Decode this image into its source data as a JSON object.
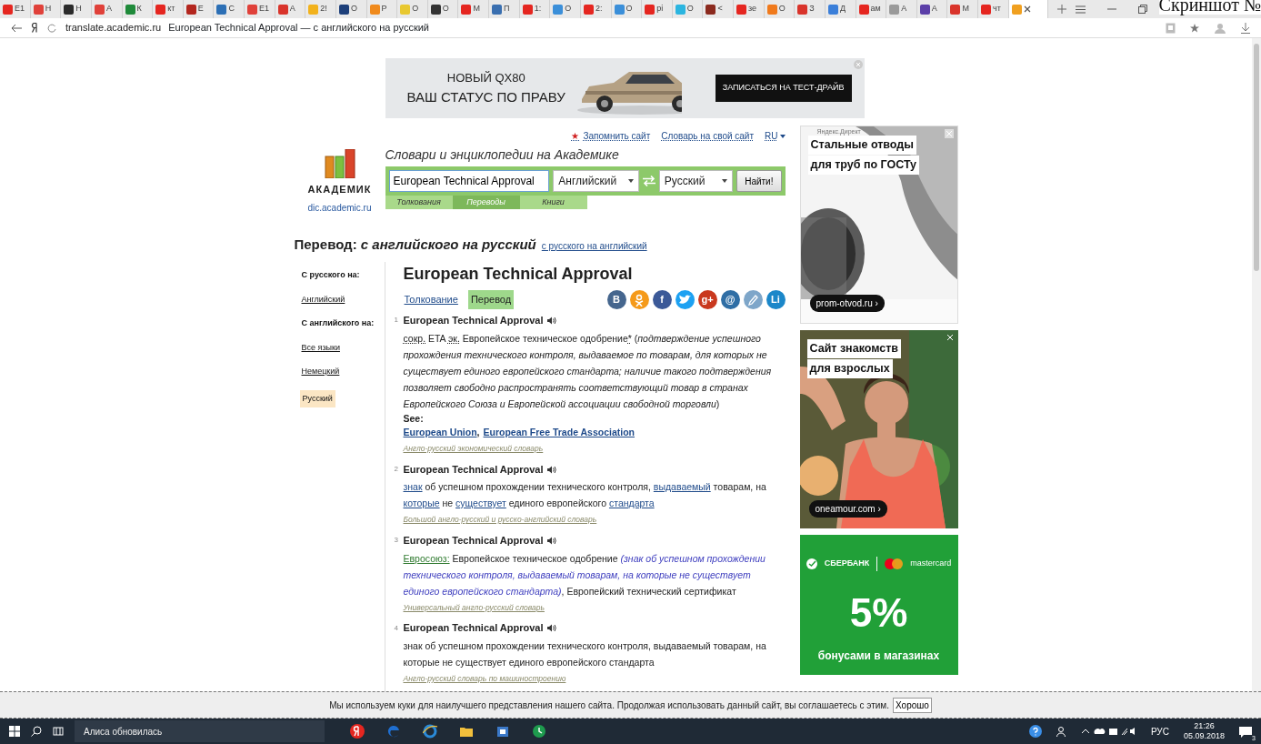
{
  "browser": {
    "tabs": [
      {
        "label": "Е1",
        "color": "#e52620",
        "selected": false
      },
      {
        "label": "Н",
        "color": "#e0413a",
        "selected": false
      },
      {
        "label": "Н",
        "color": "#2b2b2b",
        "selected": false
      },
      {
        "label": "А",
        "color": "#e0413a",
        "selected": false
      },
      {
        "label": "К",
        "color": "#1f8a3a",
        "selected": false
      },
      {
        "label": "кт",
        "color": "#e52620",
        "selected": false
      },
      {
        "label": "Е",
        "color": "#b3261e",
        "selected": false
      },
      {
        "label": "С",
        "color": "#2c6fb5",
        "selected": false
      },
      {
        "label": "Е1",
        "color": "#e0413a",
        "selected": false
      },
      {
        "label": "А",
        "color": "#d9342b",
        "selected": false
      },
      {
        "label": "2!",
        "color": "#f2b21c",
        "selected": false
      },
      {
        "label": "О",
        "color": "#1d3f7a",
        "selected": false
      },
      {
        "label": "Р",
        "color": "#f08a1c",
        "selected": false
      },
      {
        "label": "О",
        "color": "#e8c830",
        "selected": false
      },
      {
        "label": "О",
        "color": "#333333",
        "selected": false
      },
      {
        "label": "М",
        "color": "#e52620",
        "selected": false
      },
      {
        "label": "П",
        "color": "#3a6fb0",
        "selected": false
      },
      {
        "label": "1:",
        "color": "#e52620",
        "selected": false
      },
      {
        "label": "О",
        "color": "#3b8fd9",
        "selected": false
      },
      {
        "label": "2:",
        "color": "#e52620",
        "selected": false
      },
      {
        "label": "О",
        "color": "#3b8fd9",
        "selected": false
      },
      {
        "label": "рі",
        "color": "#e52620",
        "selected": false
      },
      {
        "label": "О",
        "color": "#2bb5e0",
        "selected": false
      },
      {
        "label": "<",
        "color": "#8b2a1e",
        "selected": false
      },
      {
        "label": "зе",
        "color": "#e52620",
        "selected": false
      },
      {
        "label": "О",
        "color": "#f07a1c",
        "selected": false
      },
      {
        "label": "З",
        "color": "#d9342b",
        "selected": false
      },
      {
        "label": "Д",
        "color": "#3b7fd9",
        "selected": false
      },
      {
        "label": "ам",
        "color": "#e52620",
        "selected": false
      },
      {
        "label": "А",
        "color": "#9a9a9a",
        "selected": false
      },
      {
        "label": "А",
        "color": "#5b3fa8",
        "selected": false
      },
      {
        "label": "М",
        "color": "#d9342b",
        "selected": false
      },
      {
        "label": "чт",
        "color": "#e52620",
        "selected": false
      },
      {
        "color": "#f0a020",
        "selected": true
      }
    ],
    "corner_caption": "Скриншот №",
    "address": {
      "domain": "translate.academic.ru",
      "title": "European Technical Approval — с английского на русский"
    }
  },
  "banner": {
    "line_1": "НОВЫЙ QX80",
    "line_2": "ВАШ СТАТУС ПО ПРАВУ",
    "cta": "ЗАПИСАТЬСЯ НА ТЕСТ-ДРАЙВ"
  },
  "top_links": [
    {
      "label": "Запомнить сайт",
      "star": "★"
    },
    {
      "label": "Словарь на свой сайт"
    },
    {
      "label": "RU"
    }
  ],
  "logo": {
    "name": "АКАДЕМИК",
    "domain": "dic.academic.ru"
  },
  "search": {
    "heading": "Словари и энциклопедии на Академике",
    "query": "European Technical Approval",
    "from_lang": "Английский",
    "to_lang": "Русский",
    "button": "Найти!",
    "tabs": [
      {
        "label": "Толкования",
        "selected": false
      },
      {
        "label": "Переводы",
        "selected": true
      },
      {
        "label": "Книги",
        "selected": false
      }
    ]
  },
  "page_title": {
    "prefix": "Перевод:",
    "direction": "с английского на русский",
    "reverse_link": "с русского на английский"
  },
  "sidebar": [
    {
      "kind": "heading",
      "label": "С русского на:"
    },
    {
      "kind": "link",
      "label": "Английский",
      "selected": false
    },
    {
      "kind": "heading",
      "label": "С английского на:"
    },
    {
      "kind": "link",
      "label": "Все языки",
      "selected": false
    },
    {
      "kind": "link",
      "label": "Немецкий",
      "selected": false
    },
    {
      "kind": "link",
      "label": "Русский",
      "selected": true
    }
  ],
  "article": {
    "title": "European Technical Approval",
    "modes": [
      {
        "label": "Толкование",
        "selected": false
      },
      {
        "label": "Перевод",
        "selected": true
      }
    ],
    "share": [
      {
        "kind": "text",
        "label": "B",
        "color": "#45668e"
      },
      {
        "kind": "person",
        "color": "#f59a1a"
      },
      {
        "kind": "text",
        "label": "f",
        "color": "#3b5998"
      },
      {
        "kind": "bird",
        "color": "#1da1f2"
      },
      {
        "kind": "text",
        "label": "g+",
        "color": "#c9381e"
      },
      {
        "kind": "text",
        "label": "@",
        "color": "#2f6ea5"
      },
      {
        "kind": "pencil",
        "color": "#7ea6c9"
      },
      {
        "kind": "text",
        "label": "Li",
        "color": "#1b87c9"
      }
    ],
    "entries": [
      {
        "number": "1",
        "term": "European Technical Approval",
        "body": [
          {
            "kind": "abbr",
            "text": "сокр."
          },
          {
            "kind": "plain",
            "text": " ETA "
          },
          {
            "kind": "abbr",
            "text": "эк."
          },
          {
            "kind": "plain",
            "text": " Европейское техническое одобрение"
          },
          {
            "kind": "abbr",
            "text": "*"
          },
          {
            "kind": "plain",
            "text": " ("
          },
          {
            "kind": "italic",
            "text": "подтверждение успешного прохождения технического контроля, выдаваемое по товарам, для которых не существует единого европейского стандарта; наличие такого подтверждения позволяет свободно распространять соответствующий товар в странах Европейского Союза и Европейской ассоциации свободной торговли"
          },
          {
            "kind": "plain",
            "text": ")"
          }
        ],
        "see_label": "See:",
        "see_separator": ",",
        "see_links": [
          "European Union",
          "European Free Trade Association"
        ],
        "source": "Англо-русский экономический словарь"
      },
      {
        "number": "2",
        "term": "European Technical Approval",
        "body": [
          {
            "kind": "link",
            "text": "знак"
          },
          {
            "kind": "plain",
            "text": " об успешном прохождении технического контроля, "
          },
          {
            "kind": "link",
            "text": "выдаваемый"
          },
          {
            "kind": "plain",
            "text": " товарам, на "
          },
          {
            "kind": "link",
            "text": "которые"
          },
          {
            "kind": "plain",
            "text": " не "
          },
          {
            "kind": "link",
            "text": "существует"
          },
          {
            "kind": "plain",
            "text": " единого европейского "
          },
          {
            "kind": "link",
            "text": "стандарта"
          }
        ],
        "source": "Большой англо-русский и русско-английский словарь"
      },
      {
        "number": "3",
        "term": "European Technical Approval",
        "body": [
          {
            "kind": "label",
            "text": "Евросоюз:"
          },
          {
            "kind": "plain",
            "text": " Европейское техническое одобрение "
          },
          {
            "kind": "note",
            "text": "(знак об успешном прохождении технического контроля, выдаваемый товарам, на которые не существует единого европейского стандарта)"
          },
          {
            "kind": "plain",
            "text": ", Европейский технический сертификат"
          }
        ],
        "source": "Универсальный англо-русский словарь"
      },
      {
        "number": "4",
        "term": "European Technical Approval",
        "body": [
          {
            "kind": "plain",
            "text": "знак об успешном прохождении технического контроля, выдаваемый товарам, на которые не существует единого европейского стандарта"
          }
        ],
        "source": "Англо-русский словарь по машиностроению"
      }
    ]
  },
  "ads": [
    {
      "kind": "pipes",
      "label": "Яндекс.Директ",
      "headline": [
        "Стальные отводы",
        "для труб по ГОСТу"
      ],
      "domain": "prom-otvod.ru ›"
    },
    {
      "kind": "portrait",
      "headline": [
        "Сайт знакомств",
        "для взрослых"
      ],
      "domain": "oneamour.com ›"
    },
    {
      "kind": "bank",
      "brand": "СБЕРБАНК",
      "partner": "mastercard",
      "big": "5%",
      "caption": "бонусами в магазинах"
    }
  ],
  "cookie_bar": {
    "text": "Мы используем куки для наилучшего представления нашего сайта. Продолжая использовать данный сайт, вы соглашаетесь с этим.",
    "button": "Хорошо"
  },
  "taskbar": {
    "search": "Алиса обновилась",
    "apps": [
      {
        "kind": "yandex",
        "color": "#e52620"
      },
      {
        "kind": "edge",
        "color": "#1f6fd1"
      },
      {
        "kind": "ie",
        "color": "#2a8ad8"
      },
      {
        "kind": "folder",
        "color": "#f2c03c"
      },
      {
        "kind": "store",
        "color": "#3b79c9"
      },
      {
        "kind": "clock",
        "color": "#1e9b4e"
      }
    ],
    "lang": "РУС",
    "time": "21:26",
    "date": "05.09.2018",
    "notifications": "3"
  }
}
